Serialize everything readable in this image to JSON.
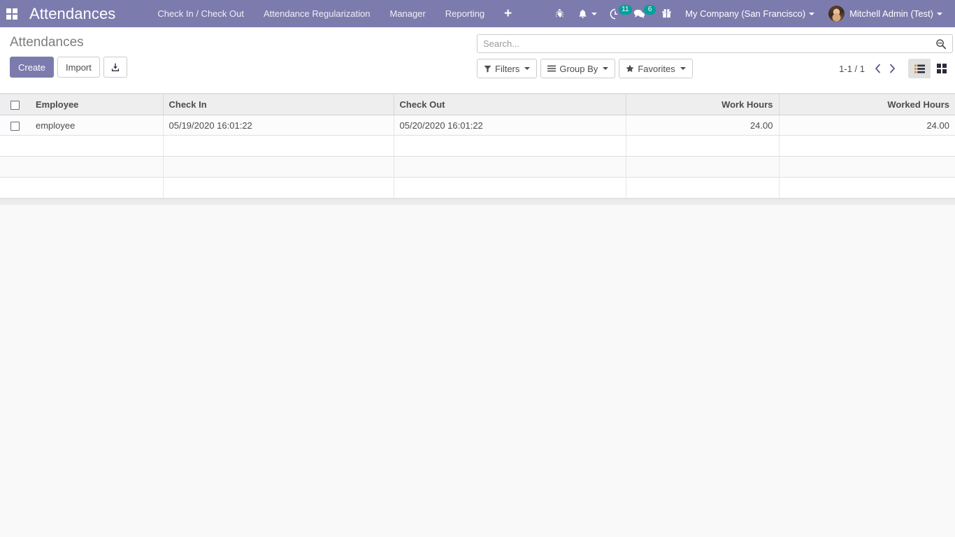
{
  "navbar": {
    "apps_icon": "apps-grid-icon",
    "brand": "Attendances",
    "menu_items": [
      {
        "label": "Check In / Check Out"
      },
      {
        "label": "Attendance Regularization"
      },
      {
        "label": "Manager"
      },
      {
        "label": "Reporting"
      }
    ],
    "plus_label": "+",
    "icons": [
      {
        "name": "bug-icon",
        "badge": ""
      },
      {
        "name": "bell-icon",
        "badge": ""
      },
      {
        "name": "activity-clock-icon",
        "badge": "11"
      },
      {
        "name": "messages-icon",
        "badge": "6"
      },
      {
        "name": "gift-icon",
        "badge": ""
      }
    ],
    "activity_count": "11",
    "messages_count": "6",
    "company": "My Company (San Francisco)",
    "user": "Mitchell Admin (Test)"
  },
  "control_panel": {
    "title": "Attendances",
    "create_label": "Create",
    "import_label": "Import",
    "export_icon": "download-icon",
    "search": {
      "placeholder": "Search...",
      "value": "",
      "icon": "search-icon"
    },
    "filters_label": "Filters",
    "group_by_label": "Group By",
    "favorites_label": "Favorites",
    "pager": "1-1 / 1",
    "prev_icon": "chevron-left-icon",
    "next_icon": "chevron-right-icon",
    "views": [
      {
        "name": "list-view",
        "label": "List",
        "active": true
      },
      {
        "name": "kanban-view",
        "label": "Kanban",
        "active": false
      }
    ]
  },
  "table": {
    "columns": [
      {
        "label": "Employee",
        "align": "left"
      },
      {
        "label": "Check In",
        "align": "left"
      },
      {
        "label": "Check Out",
        "align": "left"
      },
      {
        "label": "Work Hours",
        "align": "right"
      },
      {
        "label": "Worked Hours",
        "align": "right"
      }
    ],
    "rows": [
      {
        "employee": "employee",
        "check_in": "05/19/2020 16:01:22",
        "check_out": "05/20/2020 16:01:22",
        "work_hours": "24.00",
        "worked_hours": "24.00"
      }
    ]
  },
  "colors": {
    "brand_purple": "#7c7bad",
    "badge_teal": "#00a09d",
    "header_gray": "#eeeeee",
    "page_bg": "#f9f9f9"
  }
}
